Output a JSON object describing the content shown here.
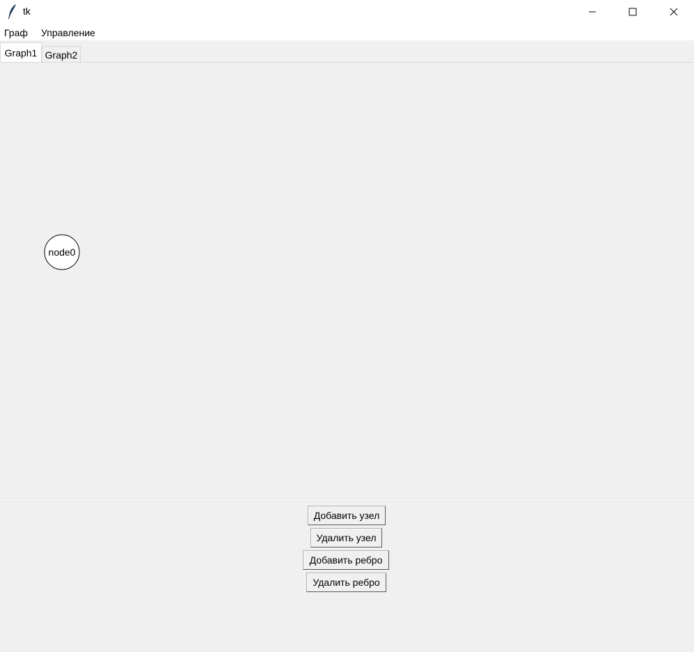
{
  "window": {
    "title": "tk",
    "icon": "tk-feather-icon",
    "controls": [
      "minimize-icon",
      "maximize-icon",
      "close-icon"
    ]
  },
  "menubar": {
    "items": [
      "Граф",
      "Управление"
    ]
  },
  "tabs": {
    "items": [
      "Graph1",
      "Graph2"
    ],
    "active": "Graph1"
  },
  "graph": {
    "nodes": [
      {
        "label": "node0"
      }
    ],
    "edges": []
  },
  "controls": {
    "add_node": "Добавить узел",
    "remove_node": "Удалить узел",
    "add_edge": "Добавить ребро",
    "remove_edge": "Удалить ребро"
  }
}
